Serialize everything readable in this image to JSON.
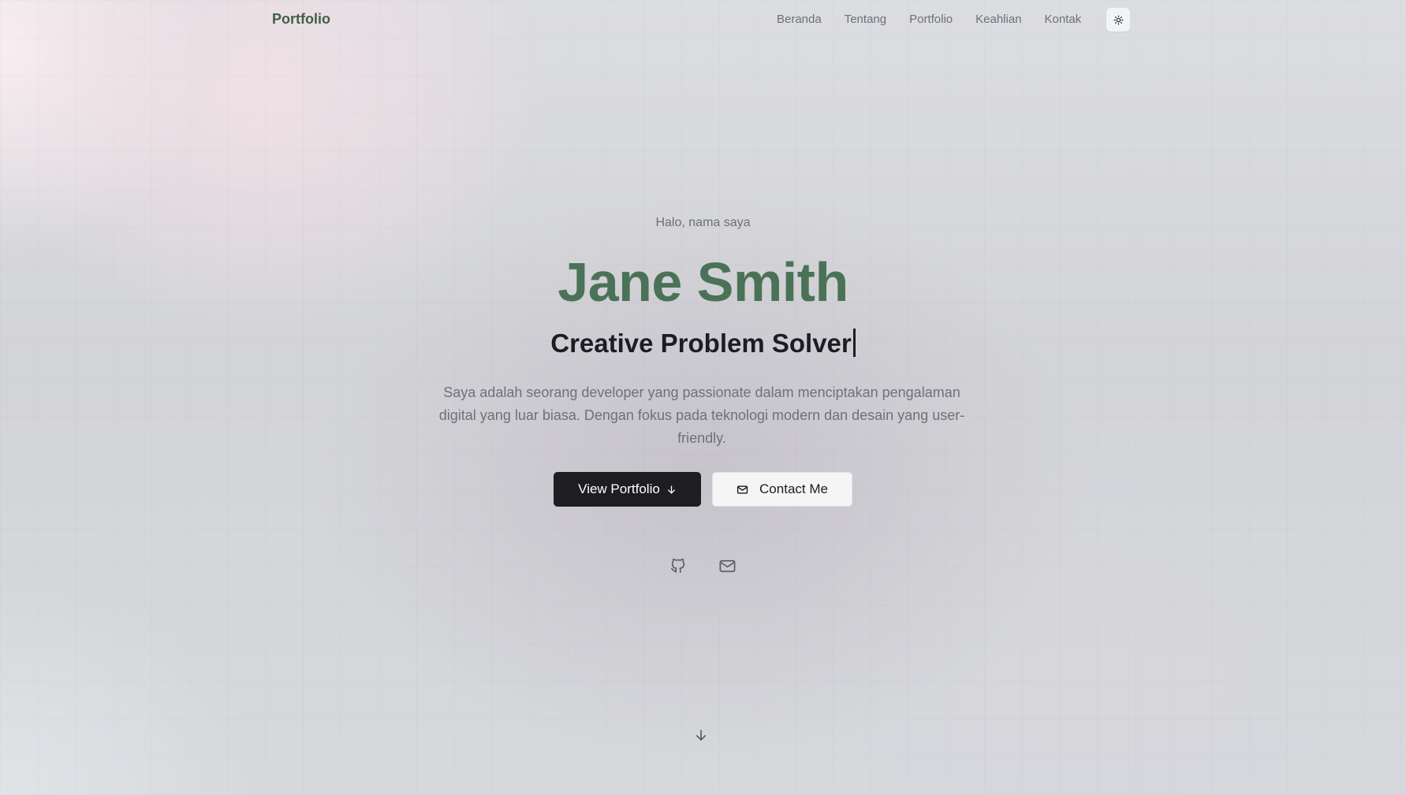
{
  "nav": {
    "brand": "Portfolio",
    "links": [
      {
        "label": "Beranda"
      },
      {
        "label": "Tentang"
      },
      {
        "label": "Portfolio"
      },
      {
        "label": "Keahlian"
      },
      {
        "label": "Kontak"
      }
    ],
    "theme_icon": "sun-icon"
  },
  "hero": {
    "greeting": "Halo, nama saya",
    "name": "Jane Smith",
    "role": "Creative Problem Solver",
    "description": "Saya adalah seorang developer yang passionate dalam menciptakan pengalaman digital yang luar biasa. Dengan fokus pada teknologi modern dan desain yang user-friendly.",
    "primary_button": {
      "label": "View Portfolio",
      "icon": "arrow-down-icon"
    },
    "secondary_button": {
      "label": "Contact Me",
      "icon": "mail-icon"
    },
    "socials": [
      {
        "icon": "github-icon"
      },
      {
        "icon": "mail-icon"
      }
    ],
    "scroll_icon": "arrow-down-icon"
  },
  "colors": {
    "brand": "#3f5f47",
    "name_accent": "#4a7257",
    "primary_button": "#1e1d22",
    "text_muted": "#6b6f78"
  }
}
